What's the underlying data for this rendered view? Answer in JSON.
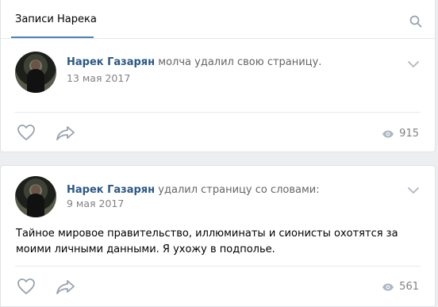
{
  "tabs": [
    {
      "label": "Записи Нарека",
      "active": true
    }
  ],
  "posts": [
    {
      "author": "Нарек Газарян",
      "action": "молча удалил свою страницу.",
      "date": "13 мая 2017",
      "text": "",
      "views": "915"
    },
    {
      "author": "Нарек Газарян",
      "action": "удалил страницу со словами:",
      "date": "9 мая 2017",
      "text": "Тайное мировое правительство, иллюминаты и сионисты охотятся за моими личными данными. Я ухожу в подполье.",
      "views": "561"
    }
  ],
  "icons": {
    "search": "search-icon",
    "more": "chevron-down-icon",
    "like": "heart-icon",
    "share": "share-arrow-icon",
    "views": "eye-icon"
  },
  "colors": {
    "accent": "#5181b8",
    "author": "#2a5885",
    "muted": "#828282",
    "background": "#edeef0"
  }
}
